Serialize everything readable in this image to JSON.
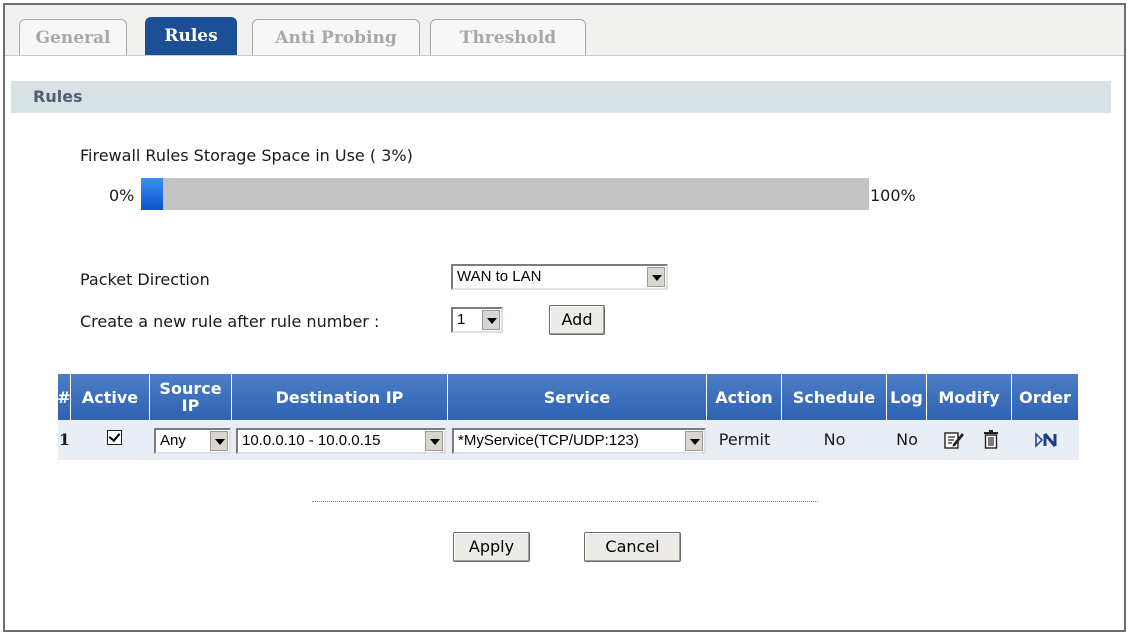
{
  "tabs": [
    {
      "label": "General",
      "active": false
    },
    {
      "label": "Rules",
      "active": true
    },
    {
      "label": "Anti Probing",
      "active": false
    },
    {
      "label": "Threshold",
      "active": false
    }
  ],
  "section_title": "Rules",
  "storage": {
    "label": "Firewall Rules Storage Space in Use",
    "percent_text": "( 3%)",
    "percent_value": 3,
    "min_label": "0%",
    "max_label": "100%"
  },
  "packet_direction": {
    "label": "Packet Direction",
    "value": "WAN to LAN"
  },
  "create_rule": {
    "label": "Create a new rule after rule number :",
    "value": "1",
    "add_label": "Add"
  },
  "table": {
    "headers": {
      "num": "#",
      "active": "Active",
      "source_ip": "Source IP",
      "destination_ip": "Destination IP",
      "service": "Service",
      "action": "Action",
      "schedule": "Schedule",
      "log": "Log",
      "modify": "Modify",
      "order": "Order"
    },
    "rows": [
      {
        "num": "1",
        "active": true,
        "source_ip": "Any",
        "destination_ip": "10.0.0.10 - 10.0.0.15",
        "service": "*MyService(TCP/UDP:123)",
        "action": "Permit",
        "schedule": "No",
        "log": "No",
        "order_icon": "move-order-icon"
      }
    ]
  },
  "buttons": {
    "apply": "Apply",
    "cancel": "Cancel"
  },
  "colors": {
    "accent": "#1c4f96",
    "header_bg": "#3d6fbd",
    "section_bg": "#d8e1e3",
    "row_bg": "#e9eef6",
    "progress": "#1f6ee0"
  }
}
